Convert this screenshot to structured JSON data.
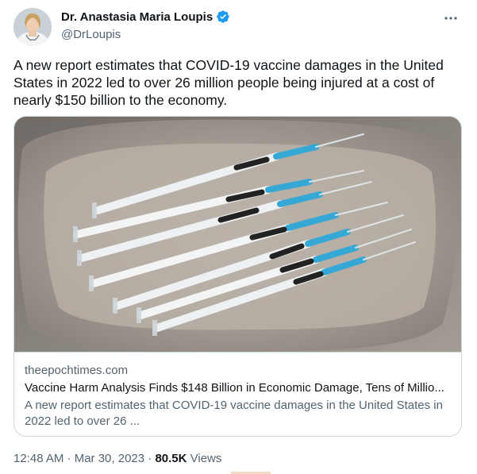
{
  "author": {
    "display_name": "Dr. Anastasia Maria Loupis",
    "handle": "@DrLoupis",
    "verified": true
  },
  "tweet": {
    "text": "A new report estimates that COVID-19 vaccine damages in the United States in 2022 led to over 26 million people being injured at a cost of nearly $150 billion to the economy."
  },
  "card": {
    "image_subject": "syringes-in-tray",
    "domain": "theepochtimes.com",
    "title": "Vaccine Harm Analysis Finds $148 Billion in Economic Damage, Tens of Millio...",
    "description": "A new report estimates that COVID-19 vaccine damages in the United States in 2022 led to over 26 ..."
  },
  "meta": {
    "timestamp": "12:48 AM · Mar 30, 2023 · ",
    "views_count": "80.5K",
    "views_label": " Views"
  },
  "colors": {
    "verified_blue": "#1d9bf0",
    "secondary_text": "#536471",
    "border": "#cfd9de"
  },
  "icons": {
    "more": "more-horizontal-icon",
    "verified": "verified-badge-icon"
  }
}
